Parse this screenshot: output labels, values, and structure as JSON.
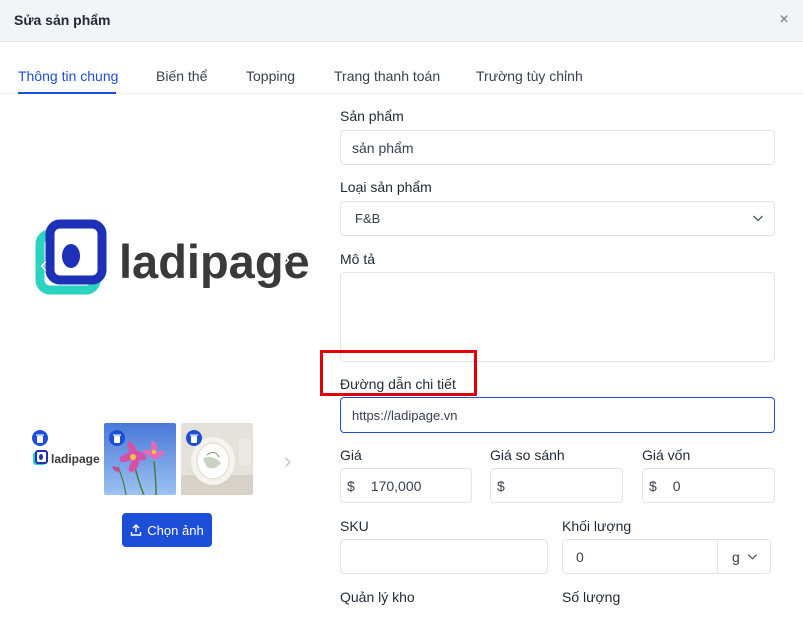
{
  "modal": {
    "title": "Sửa sản phẩm",
    "close_glyph": "×"
  },
  "tabs": [
    {
      "label": "Thông tin chung",
      "active": true
    },
    {
      "label": "Biến thể",
      "active": false
    },
    {
      "label": "Topping",
      "active": false
    },
    {
      "label": "Trang thanh toán",
      "active": false
    },
    {
      "label": "Trường tùy chỉnh",
      "active": false
    }
  ],
  "media": {
    "logo_text": "ladipage",
    "upload_label": "Chọn ảnh",
    "thumbnails": [
      "ladipage-logo",
      "cosmos-flowers",
      "cake-photo"
    ]
  },
  "form": {
    "product": {
      "label": "Sản phẩm",
      "value": "sản phẩm"
    },
    "type": {
      "label": "Loại sản phẩm",
      "value": "F&B"
    },
    "description": {
      "label": "Mô tả",
      "value": ""
    },
    "link": {
      "label": "Đường dẫn chi tiết",
      "value": "https://ladipage.vn"
    },
    "price": {
      "label": "Giá",
      "prefix": "$",
      "value": "170,000"
    },
    "compare_price": {
      "label": "Giá so sánh",
      "prefix": "$",
      "value": ""
    },
    "cost": {
      "label": "Giá vốn",
      "prefix": "$",
      "value": "0"
    },
    "sku": {
      "label": "SKU",
      "value": ""
    },
    "weight": {
      "label": "Khối lượng",
      "value": "0",
      "unit": "g"
    },
    "inventory": {
      "label": "Quản lý kho"
    },
    "quantity": {
      "label": "Số lượng"
    }
  },
  "colors": {
    "accent": "#1d4ed8",
    "highlight": "#e00000",
    "logo_teal": "#2ad4c0",
    "logo_blue": "#1e2fb8",
    "logo_text": "#3a3a3a"
  }
}
